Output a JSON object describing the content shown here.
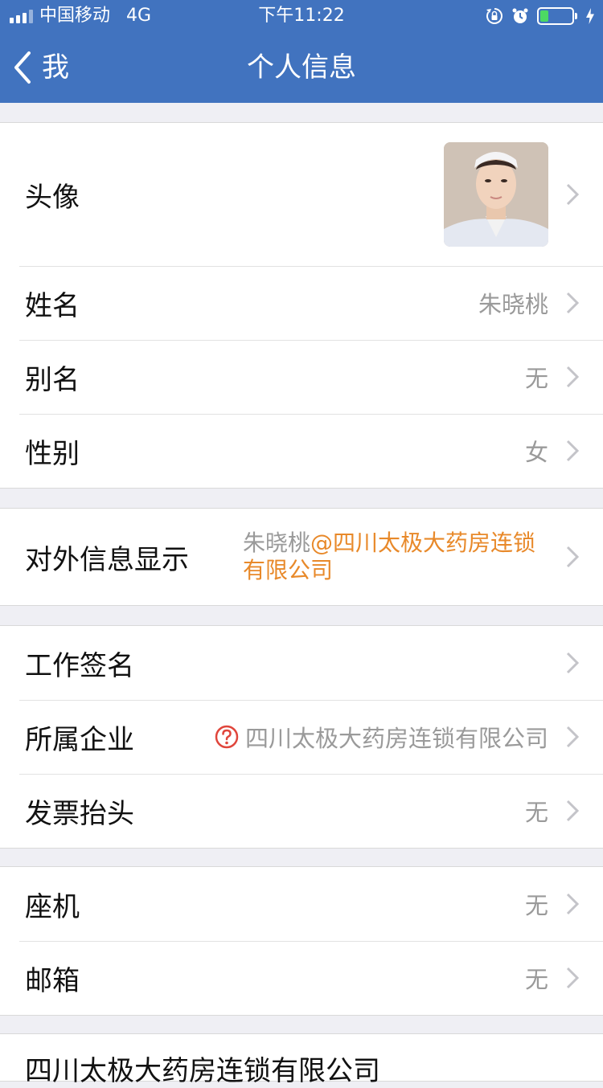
{
  "status_bar": {
    "carrier": "中国移动",
    "network": "4G",
    "time": "下午11:22",
    "battery_level_fraction": 0.25,
    "icons": [
      "signal-icon",
      "rotation-lock-icon",
      "alarm-icon",
      "battery-icon",
      "charging-icon"
    ]
  },
  "nav": {
    "back_label": "我",
    "title": "个人信息"
  },
  "profile": {
    "avatar_label": "头像",
    "name_label": "姓名",
    "name_value": "朱晓桃",
    "alias_label": "别名",
    "alias_value": "无",
    "gender_label": "性别",
    "gender_value": "女"
  },
  "external": {
    "label": "对外信息显示",
    "name": "朱晓桃",
    "org": "@四川太极大药房连锁有限公司"
  },
  "work": {
    "signature_label": "工作签名",
    "enterprise_label": "所属企业",
    "enterprise_value": "四川太极大药房连锁有限公司",
    "invoice_label": "发票抬头",
    "invoice_value": "无"
  },
  "contact": {
    "landline_label": "座机",
    "landline_value": "无",
    "email_label": "邮箱",
    "email_value": "无"
  },
  "footer": {
    "text": "四川太极大药房连锁有限公司"
  },
  "colors": {
    "accent": "#4173bf",
    "background": "#efeff4",
    "highlight": "#e8892a",
    "warning": "#e0463c"
  }
}
